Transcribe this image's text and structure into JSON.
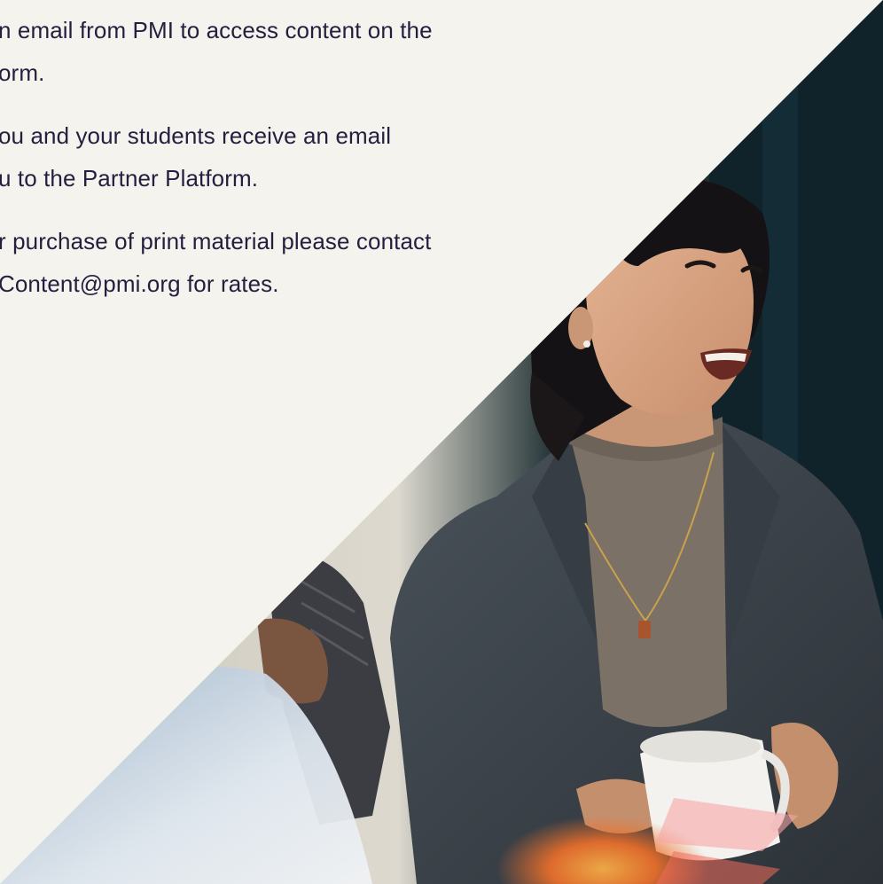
{
  "paragraphs": [
    {
      "lines": [
        "n email from PMI to access content on the",
        "orm."
      ]
    },
    {
      "lines": [
        "ou and your students receive an email",
        "u to the Partner Platform."
      ]
    },
    {
      "lines": [
        "r purchase of print material please contact",
        "Content@pmi.org for rates."
      ]
    }
  ],
  "photo": {
    "subject": "woman-laughing-with-coffee-mug",
    "colors": {
      "background_page": "#f5f3ee",
      "text": "#241f3f",
      "wall_dark": "#14262a",
      "wall_light": "#d9d6cc",
      "blazer": "#3a4148",
      "turtleneck": "#7d7367",
      "skin": "#d8a584",
      "hair": "#141214"
    }
  }
}
